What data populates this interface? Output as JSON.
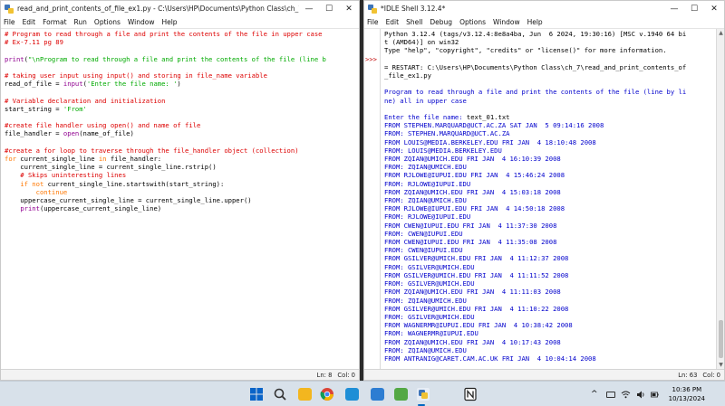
{
  "editor": {
    "title": "read_and_print_contents_of_file_ex1.py - C:\\Users\\HP\\Documents\\Python Class\\ch_7\\read_and_...",
    "menu": [
      "File",
      "Edit",
      "Format",
      "Run",
      "Options",
      "Window",
      "Help"
    ],
    "status": {
      "line": "Ln: 8",
      "col": "Col: 0"
    },
    "lines": [
      [
        {
          "t": "# Program to read through a file and print the contents of the file in upper case",
          "c": "cm"
        }
      ],
      [
        {
          "t": "# Ex-7.11 pg 89",
          "c": "cm"
        }
      ],
      [
        {
          "t": "",
          "c": "def"
        }
      ],
      [
        {
          "t": "print",
          "c": "bi"
        },
        {
          "t": "(",
          "c": "def"
        },
        {
          "t": "\"\\nProgram to read through a file and print the contents of the file (line b",
          "c": "str"
        }
      ],
      [
        {
          "t": "",
          "c": "def"
        }
      ],
      [
        {
          "t": "# taking user input using input() and storing in file_name variable",
          "c": "cm"
        }
      ],
      [
        {
          "t": "read_of_file = ",
          "c": "def"
        },
        {
          "t": "input",
          "c": "bi"
        },
        {
          "t": "(",
          "c": "def"
        },
        {
          "t": "'Enter the file name: '",
          "c": "str"
        },
        {
          "t": ")",
          "c": "def"
        }
      ],
      [
        {
          "t": "",
          "c": "def"
        }
      ],
      [
        {
          "t": "# Variable declaration and initialization",
          "c": "cm"
        }
      ],
      [
        {
          "t": "start_string = ",
          "c": "def"
        },
        {
          "t": "'From'",
          "c": "str"
        }
      ],
      [
        {
          "t": "",
          "c": "def"
        }
      ],
      [
        {
          "t": "#create file handler using open() and name of file",
          "c": "cm"
        }
      ],
      [
        {
          "t": "file_handler = ",
          "c": "def"
        },
        {
          "t": "open",
          "c": "bi"
        },
        {
          "t": "(name_of_file)",
          "c": "def"
        }
      ],
      [
        {
          "t": "",
          "c": "def"
        }
      ],
      [
        {
          "t": "#create a for loop to traverse through the file_handler object (collection)",
          "c": "cm"
        }
      ],
      [
        {
          "t": "for",
          "c": "kw"
        },
        {
          "t": " current_single_line ",
          "c": "def"
        },
        {
          "t": "in",
          "c": "kw"
        },
        {
          "t": " file_handler:",
          "c": "def"
        }
      ],
      [
        {
          "t": "    current_single_line = current_single_line.rstrip()",
          "c": "def"
        }
      ],
      [
        {
          "t": "    # Skips uninteresting lines",
          "c": "cm"
        }
      ],
      [
        {
          "t": "    ",
          "c": "def"
        },
        {
          "t": "if not",
          "c": "kw"
        },
        {
          "t": " current_single_line.startswith(start_string):",
          "c": "def"
        }
      ],
      [
        {
          "t": "        ",
          "c": "def"
        },
        {
          "t": "continue",
          "c": "kw"
        }
      ],
      [
        {
          "t": "    uppercase_current_single_line = current_single_line.upper()",
          "c": "def"
        }
      ],
      [
        {
          "t": "    ",
          "c": "def"
        },
        {
          "t": "print",
          "c": "bi"
        },
        {
          "t": "(uppercase_current_single_line)",
          "c": "def"
        }
      ]
    ]
  },
  "shell": {
    "title": "*IDLE Shell 3.12.4*",
    "menu": [
      "File",
      "Edit",
      "Shell",
      "Debug",
      "Options",
      "Window",
      "Help"
    ],
    "prompt": ">>>",
    "status": {
      "line": "Ln: 63",
      "col": "Col: 0"
    },
    "lines": [
      [
        {
          "t": "Python 3.12.4 (tags/v3.12.4:8e8a4ba, Jun  6 2024, 19:30:16) [MSC v.1940 64 bi",
          "c": "def"
        }
      ],
      [
        {
          "t": "t (AMD64)] on win32",
          "c": "def"
        }
      ],
      [
        {
          "t": "Type \"help\", \"copyright\", \"credits\" or \"license()\" for more information.",
          "c": "def"
        }
      ],
      [
        {
          "t": "",
          "c": "def"
        }
      ],
      [
        {
          "t": "= RESTART: C:\\Users\\HP\\Documents\\Python Class\\ch_7\\read_and_print_contents_of",
          "c": "def"
        }
      ],
      [
        {
          "t": "_file_ex1.py",
          "c": "def"
        }
      ],
      [
        {
          "t": "",
          "c": "def"
        }
      ],
      [
        {
          "t": "Program to read through a file and print the contents of the file (line by li",
          "c": "out"
        }
      ],
      [
        {
          "t": "ne) all in upper case",
          "c": "out"
        }
      ],
      [
        {
          "t": "",
          "c": "def"
        }
      ],
      [
        {
          "t": "Enter the file name: ",
          "c": "out"
        },
        {
          "t": "text_01.txt",
          "c": "def"
        }
      ],
      [
        {
          "t": "FROM STEPHEN.MARQUARD@UCT.AC.ZA SAT JAN  5 09:14:16 2008",
          "c": "out"
        }
      ],
      [
        {
          "t": "FROM: STEPHEN.MARQUARD@UCT.AC.ZA",
          "c": "out"
        }
      ],
      [
        {
          "t": "FROM LOUIS@MEDIA.BERKELEY.EDU FRI JAN  4 18:10:48 2008",
          "c": "out"
        }
      ],
      [
        {
          "t": "FROM: LOUIS@MEDIA.BERKELEY.EDU",
          "c": "out"
        }
      ],
      [
        {
          "t": "FROM ZQIAN@UMICH.EDU FRI JAN  4 16:10:39 2008",
          "c": "out"
        }
      ],
      [
        {
          "t": "FROM: ZQIAN@UMICH.EDU",
          "c": "out"
        }
      ],
      [
        {
          "t": "FROM RJLOWE@IUPUI.EDU FRI JAN  4 15:46:24 2008",
          "c": "out"
        }
      ],
      [
        {
          "t": "FROM: RJLOWE@IUPUI.EDU",
          "c": "out"
        }
      ],
      [
        {
          "t": "FROM ZQIAN@UMICH.EDU FRI JAN  4 15:03:18 2008",
          "c": "out"
        }
      ],
      [
        {
          "t": "FROM: ZQIAN@UMICH.EDU",
          "c": "out"
        }
      ],
      [
        {
          "t": "FROM RJLOWE@IUPUI.EDU FRI JAN  4 14:50:18 2008",
          "c": "out"
        }
      ],
      [
        {
          "t": "FROM: RJLOWE@IUPUI.EDU",
          "c": "out"
        }
      ],
      [
        {
          "t": "FROM CWEN@IUPUI.EDU FRI JAN  4 11:37:30 2008",
          "c": "out"
        }
      ],
      [
        {
          "t": "FROM: CWEN@IUPUI.EDU",
          "c": "out"
        }
      ],
      [
        {
          "t": "FROM CWEN@IUPUI.EDU FRI JAN  4 11:35:08 2008",
          "c": "out"
        }
      ],
      [
        {
          "t": "FROM: CWEN@IUPUI.EDU",
          "c": "out"
        }
      ],
      [
        {
          "t": "FROM GSILVER@UMICH.EDU FRI JAN  4 11:12:37 2008",
          "c": "out"
        }
      ],
      [
        {
          "t": "FROM: GSILVER@UMICH.EDU",
          "c": "out"
        }
      ],
      [
        {
          "t": "FROM GSILVER@UMICH.EDU FRI JAN  4 11:11:52 2008",
          "c": "out"
        }
      ],
      [
        {
          "t": "FROM: GSILVER@UMICH.EDU",
          "c": "out"
        }
      ],
      [
        {
          "t": "FROM ZQIAN@UMICH.EDU FRI JAN  4 11:11:03 2008",
          "c": "out"
        }
      ],
      [
        {
          "t": "FROM: ZQIAN@UMICH.EDU",
          "c": "out"
        }
      ],
      [
        {
          "t": "FROM GSILVER@UMICH.EDU FRI JAN  4 11:10:22 2008",
          "c": "out"
        }
      ],
      [
        {
          "t": "FROM: GSILVER@UMICH.EDU",
          "c": "out"
        }
      ],
      [
        {
          "t": "FROM WAGNERMR@IUPUI.EDU FRI JAN  4 10:38:42 2008",
          "c": "out"
        }
      ],
      [
        {
          "t": "FROM: WAGNERMR@IUPUI.EDU",
          "c": "out"
        }
      ],
      [
        {
          "t": "FROM ZQIAN@UMICH.EDU FRI JAN  4 10:17:43 2008",
          "c": "out"
        }
      ],
      [
        {
          "t": "FROM: ZQIAN@UMICH.EDU",
          "c": "out"
        }
      ],
      [
        {
          "t": "FROM ANTRANIG@CARET.CAM.AC.UK FRI JAN  4 10:04:14 2008",
          "c": "out"
        }
      ]
    ]
  },
  "window_buttons": {
    "minimize": "—",
    "maximize": "☐",
    "close": "✕"
  },
  "taskbar": {
    "icons": [
      {
        "name": "start-icon",
        "color": "#0a64c8"
      },
      {
        "name": "search-icon",
        "color": "#333333"
      },
      {
        "name": "file-explorer-icon",
        "color": "#f3b61f"
      },
      {
        "name": "chrome-icon",
        "color": "#db4437"
      },
      {
        "name": "edge-icon",
        "color": "#1e8ed6"
      },
      {
        "name": "store-icon",
        "color": "#2d7dd2"
      },
      {
        "name": "notepad-icon",
        "color": "#53a845"
      },
      {
        "name": "idle-python-icon",
        "color": "#3d74b8"
      },
      {
        "name": "notion-icon",
        "color": "#222222"
      }
    ],
    "tray_chevron": "^",
    "time": "10:36 PM",
    "date": "10/13/2024"
  }
}
